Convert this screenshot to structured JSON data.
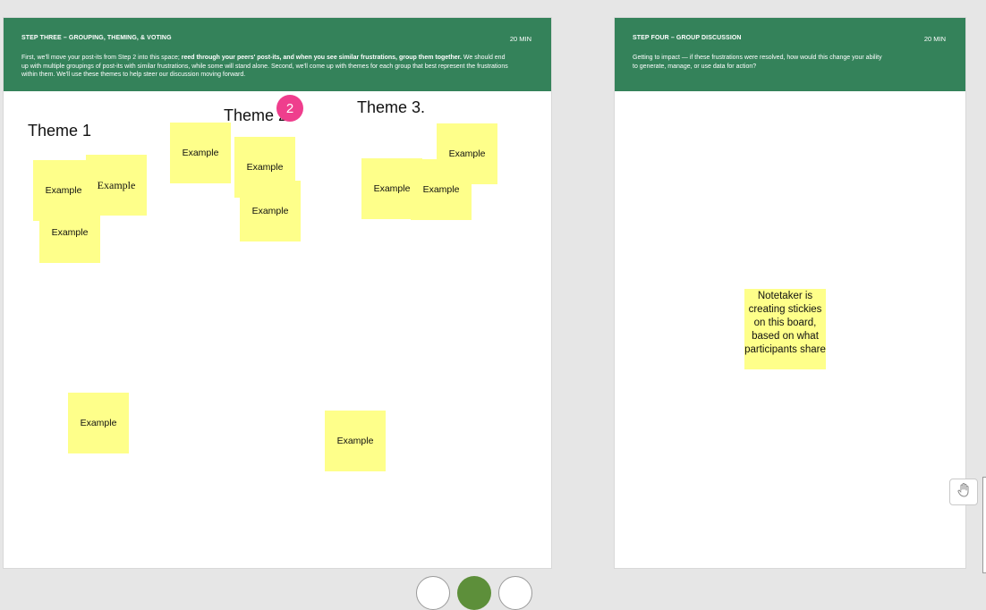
{
  "frames": [
    {
      "title": "STEP THREE – GROUPING, THEMING, & VOTING",
      "time": "20 MIN",
      "desc_before": "First, we'll move your post-its from Step 2 into this space; ",
      "desc_bold": "reed through your peers' post-its, and when you see similar frustrations, group them together.",
      "desc_after": " We should end up with multiple groupings of post-its with similar frustrations, while some will stand alone. Second, we'll come up with themes for each group that best represent the frustrations within them. We'll use these themes to help steer our discussion moving forward."
    },
    {
      "title": "STEP FOUR – GROUP DISCUSSION",
      "time": "20 MIN",
      "desc": "Getting to impact — if these frustrations were resolved, how would this change your ability to generate, manage, or use data for action?"
    }
  ],
  "themes": [
    "Theme 1",
    "Theme 2",
    "Theme 3."
  ],
  "badge_count": "2",
  "sticky_label": "Example",
  "notetaker_text": "Notetaker is creating stickies on this board, based on what participants share",
  "colors": {
    "header_green": "#34825a",
    "sticky_yellow": "#feff8a",
    "badge_pink": "#ef3e8d",
    "canvas_gray": "#e6e6e6"
  },
  "icons": {
    "hand": "hand-icon"
  }
}
